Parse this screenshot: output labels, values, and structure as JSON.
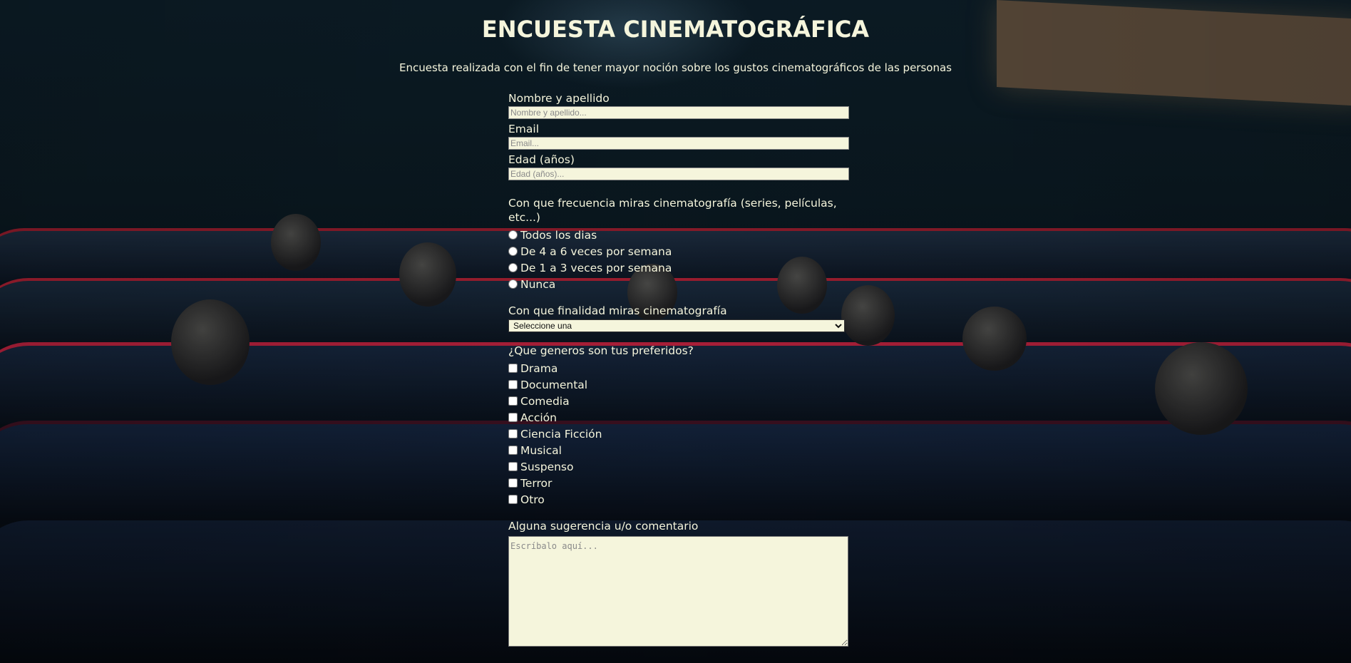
{
  "page": {
    "title": "ENCUESTA CINEMATOGRÁFICA",
    "description": "Encuesta realizada con el fin de tener mayor noción sobre los gustos cinematográficos de las personas"
  },
  "form": {
    "name": {
      "label": "Nombre y apellido",
      "placeholder": "Nombre y apellido..."
    },
    "email": {
      "label": "Email",
      "placeholder": "Email..."
    },
    "age": {
      "label": "Edad (años)",
      "placeholder": "Edad (años)..."
    },
    "frequency": {
      "question": "Con que frecuencia miras cinematografía (series, películas, etc...)",
      "options": [
        "Todos los dias",
        "De 4 a 6 veces por semana",
        "De 1 a 3 veces por semana",
        "Nunca"
      ]
    },
    "purpose": {
      "question": "Con que finalidad miras cinematografía",
      "selected": "Seleccione una"
    },
    "genres": {
      "question": "¿Que generos son tus preferidos?",
      "options": [
        "Drama",
        "Documental",
        "Comedia",
        "Acción",
        "Ciencia Ficción",
        "Musical",
        "Suspenso",
        "Terror",
        "Otro"
      ]
    },
    "comments": {
      "label": "Alguna sugerencia u/o comentario",
      "placeholder": "Escríbalo aquí..."
    }
  },
  "colors": {
    "text": "#f5f5dc",
    "input_background": "#f5f5dc"
  }
}
